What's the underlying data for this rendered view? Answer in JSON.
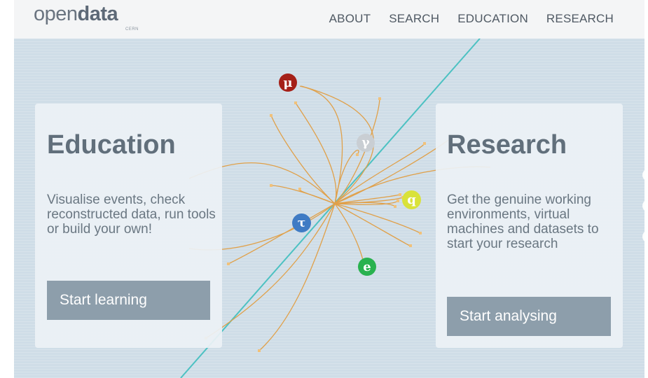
{
  "header": {
    "logo": {
      "prefix": "open",
      "bold": "data",
      "subtitle": "CERN"
    },
    "nav": [
      "ABOUT",
      "SEARCH",
      "EDUCATION",
      "RESEARCH"
    ]
  },
  "hero": {
    "particles": [
      {
        "symbol": "μ",
        "name": "muon",
        "color": "#a52018"
      },
      {
        "symbol": "γ",
        "name": "photon",
        "color": "#c9ced3"
      },
      {
        "symbol": "q",
        "name": "quark",
        "color": "#d9e23a"
      },
      {
        "symbol": "τ",
        "name": "tau",
        "color": "#3f7bc4"
      },
      {
        "symbol": "e",
        "name": "electron",
        "color": "#29b24f"
      }
    ],
    "colors": {
      "track": "#e0a049",
      "beam": "#4cc1c2",
      "background": "#cfdde7"
    }
  },
  "education": {
    "title": "Education",
    "text": "Visualise events, check reconstructed data, run tools or build your own!",
    "button": "Start learning"
  },
  "research": {
    "title": "Research",
    "text": "Get the genuine working environments, virtual machines and datasets to start your research",
    "button": "Start analysing"
  }
}
